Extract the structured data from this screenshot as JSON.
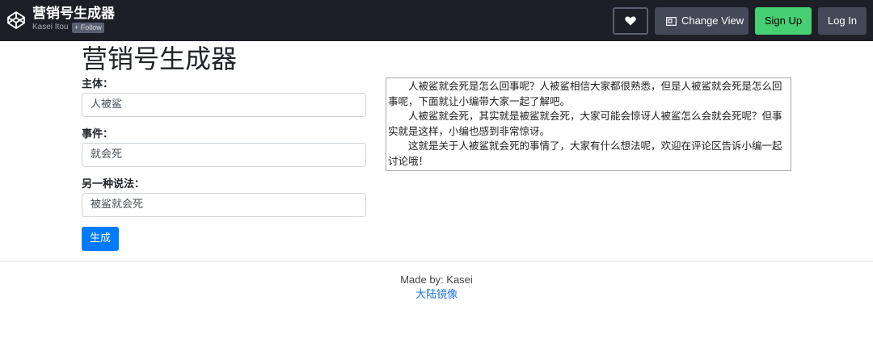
{
  "topbar": {
    "logo_icon": "codepen-logo-icon",
    "pen_title": "营销号生成器",
    "author": "Kasei Itou",
    "follow_label": "+ Follow",
    "heart_icon": "heart-icon",
    "change_view_icon": "layout-icon",
    "change_view_label": "Change View",
    "signup_label": "Sign Up",
    "login_label": "Log In",
    "colors": {
      "bar": "#1e1f26",
      "signup": "#47cf73",
      "button": "#444857"
    }
  },
  "main": {
    "title": "营销号生成器",
    "fields": [
      {
        "label": "主体：",
        "value": "人被鲨"
      },
      {
        "label": "事件：",
        "value": "就会死"
      },
      {
        "label": "另一种说法：",
        "value": "被鲨就会死"
      }
    ],
    "generate_label": "生成",
    "output_paragraphs": [
      "人被鲨就会死是怎么回事呢？人被鲨相信大家都很熟悉，但是人被鲨就会死是怎么回事呢，下面就让小编带大家一起了解吧。",
      "人被鲨就会死，其实就是被鲨就会死，大家可能会惊讶人被鲨怎么会就会死呢？但事实就是这样，小编也感到非常惊讶。",
      "这就是关于人被鲨就会死的事情了，大家有什么想法呢，欢迎在评论区告诉小编一起讨论哦！"
    ],
    "accent_color": "#007bff"
  },
  "footer": {
    "made_by": "Made by: Kasei",
    "mirror_link": "大陆镜像"
  }
}
